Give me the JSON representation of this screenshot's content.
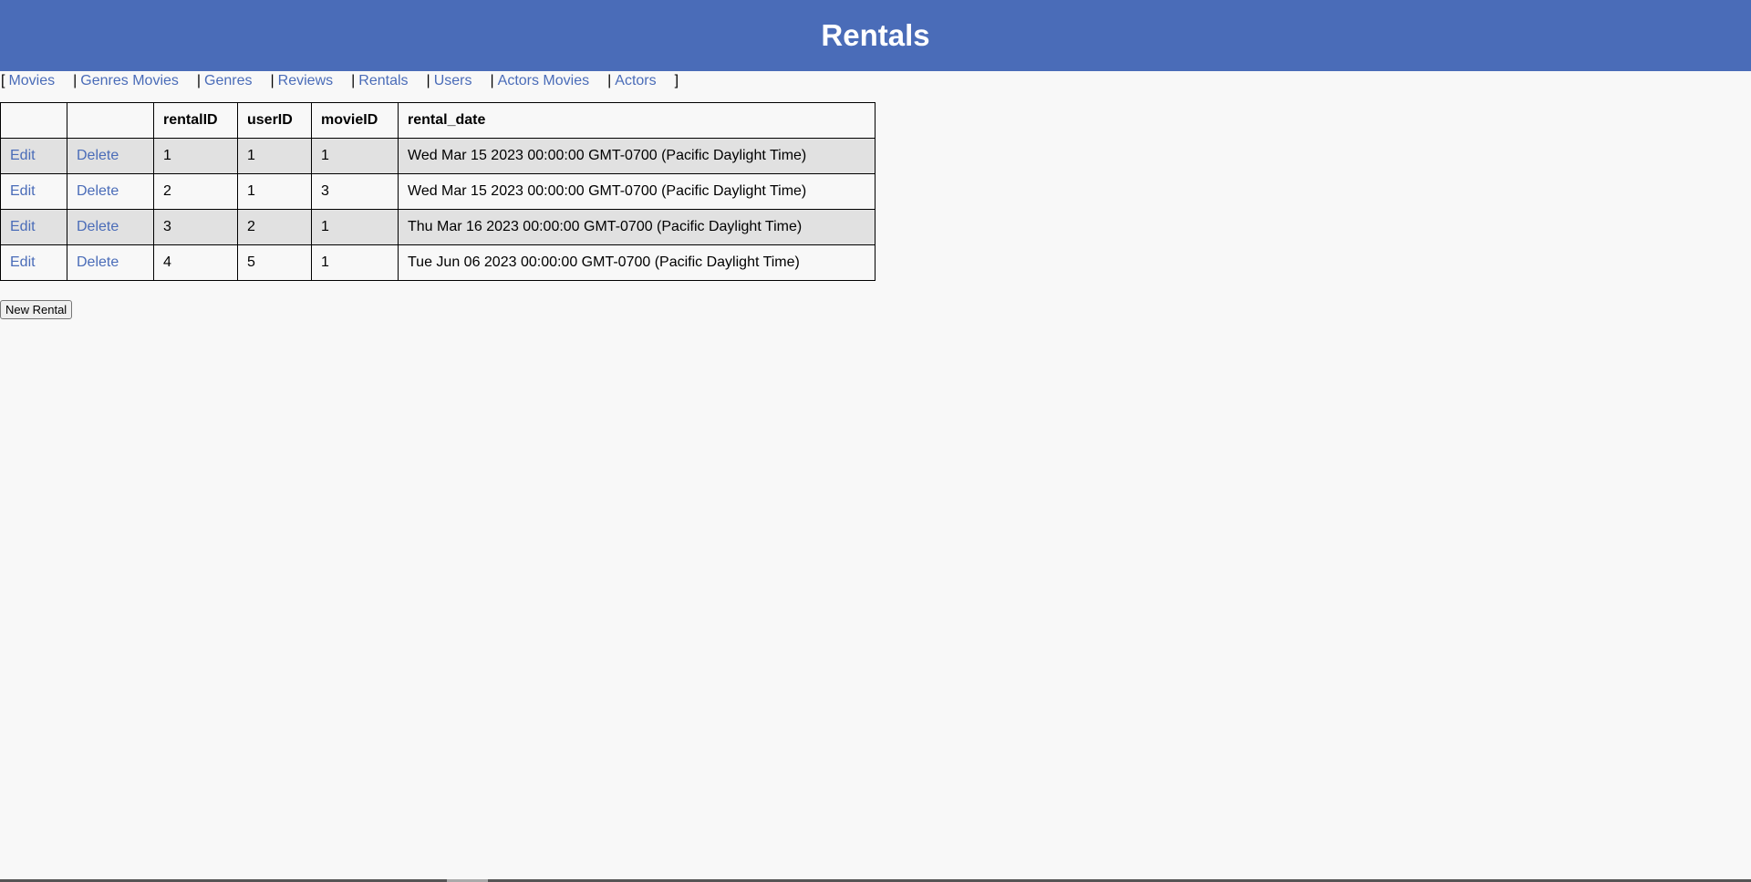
{
  "header": {
    "title": "Rentals"
  },
  "nav": {
    "open_bracket": "[",
    "close_bracket": "]",
    "separator": "|",
    "links": [
      {
        "label": "Movies"
      },
      {
        "label": "Genres Movies"
      },
      {
        "label": "Genres"
      },
      {
        "label": "Reviews"
      },
      {
        "label": "Rentals"
      },
      {
        "label": "Users"
      },
      {
        "label": "Actors Movies"
      },
      {
        "label": "Actors"
      }
    ]
  },
  "table": {
    "columns": [
      "",
      "",
      "rentalID",
      "userID",
      "movieID",
      "rental_date"
    ],
    "edit_label": "Edit",
    "delete_label": "Delete",
    "rows": [
      {
        "rentalID": "1",
        "userID": "1",
        "movieID": "1",
        "rental_date": "Wed Mar 15 2023 00:00:00 GMT-0700 (Pacific Daylight Time)"
      },
      {
        "rentalID": "2",
        "userID": "1",
        "movieID": "3",
        "rental_date": "Wed Mar 15 2023 00:00:00 GMT-0700 (Pacific Daylight Time)"
      },
      {
        "rentalID": "3",
        "userID": "2",
        "movieID": "1",
        "rental_date": "Thu Mar 16 2023 00:00:00 GMT-0700 (Pacific Daylight Time)"
      },
      {
        "rentalID": "4",
        "userID": "5",
        "movieID": "1",
        "rental_date": "Tue Jun 06 2023 00:00:00 GMT-0700 (Pacific Daylight Time)"
      }
    ]
  },
  "actions": {
    "new_rental_label": "New Rental"
  },
  "colors": {
    "accent": "#4a6cb8",
    "row_alt": "#e1e1e1",
    "background": "#f8f8f8"
  }
}
